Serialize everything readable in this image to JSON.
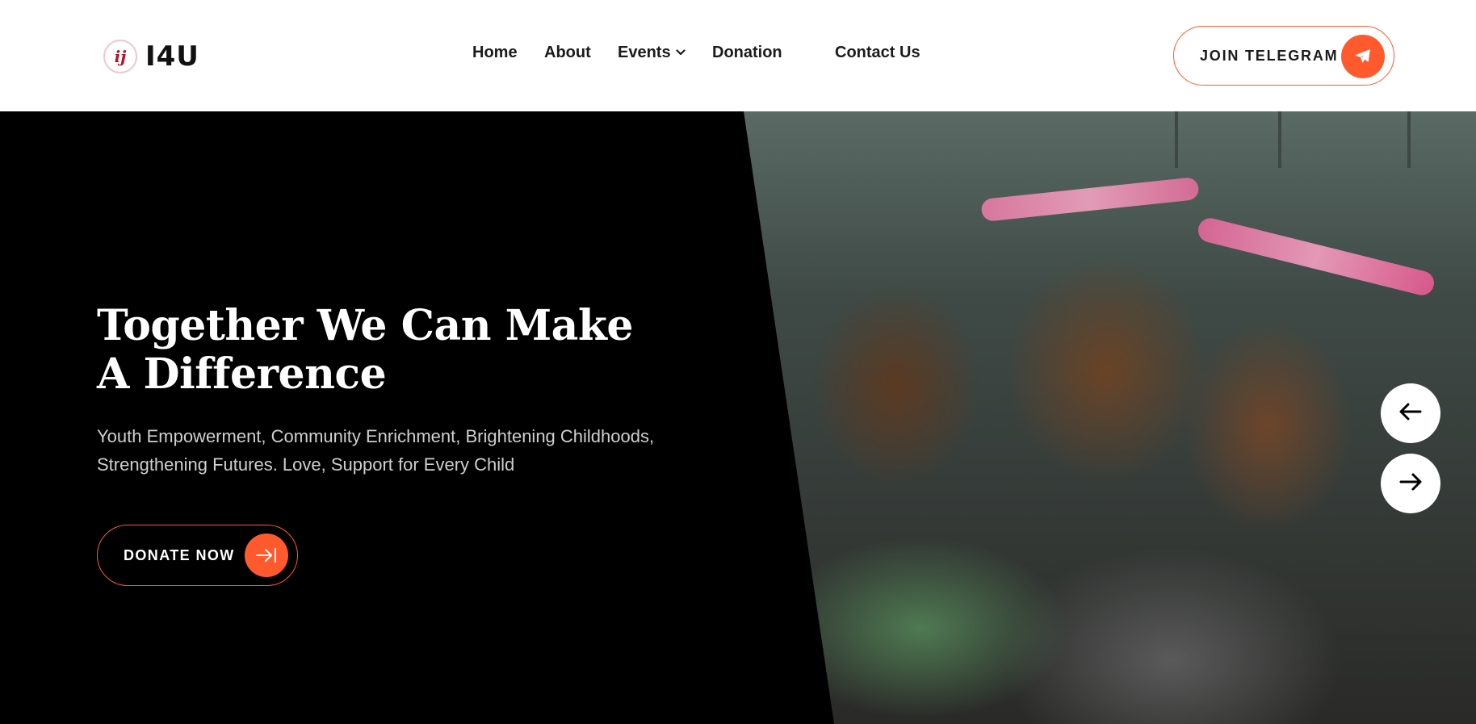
{
  "brand": {
    "logo_initials": "ij",
    "name": "I4U"
  },
  "nav": {
    "items": [
      {
        "label": "Home"
      },
      {
        "label": "About"
      },
      {
        "label": "Events"
      },
      {
        "label": "Donation"
      },
      {
        "label": "Contact Us"
      }
    ]
  },
  "header": {
    "cta_label": "JOIN TELEGRAM"
  },
  "hero": {
    "headline_line1": "Together We Can Make",
    "headline_line2": "A Difference",
    "subtitle_line1": "Youth Empowerment, Community Enrichment, Brightening Childhoods,",
    "subtitle_line2": "Strengthening Futures. Love, Support for Every Child",
    "cta_label": "DONATE NOW"
  },
  "colors": {
    "accent": "#ff5a2e",
    "background": "#000000",
    "header": "#ffffff"
  },
  "icons": {
    "telegram": "telegram-icon",
    "donate": "arrow-right-bar-icon",
    "prev": "arrow-left-icon",
    "next": "arrow-right-icon",
    "dropdown": "chevron-down-icon"
  }
}
